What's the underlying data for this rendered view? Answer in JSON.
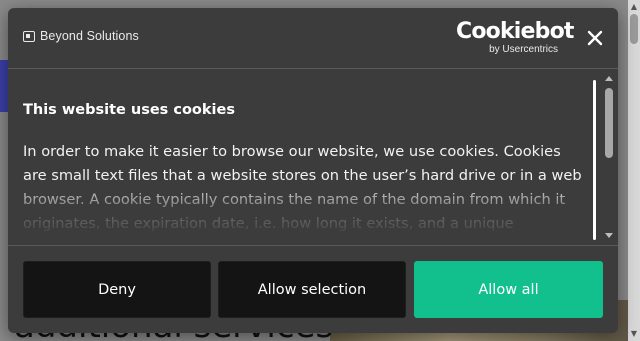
{
  "background_page": {
    "heading_fragment": "additional services"
  },
  "dialog": {
    "brand": {
      "name": "Beyond Solutions",
      "icon": "beyond-solutions-logo-icon"
    },
    "provider_logo": {
      "wordmark": "Cookiebot",
      "tagline": "by Usercentrics"
    },
    "close_icon": "close-icon",
    "title": "This website uses cookies",
    "body_text": "In order to make it easier to browse our website, we use cookies. Cookies are small text files that a website stores on the user’s hard drive or in a web browser. A cookie typically contains the name of the domain from which it originates, the expiration date, i.e. how long it exists, and a unique",
    "buttons": {
      "deny": "Deny",
      "allow_selection": "Allow selection",
      "allow_all": "Allow all"
    }
  },
  "colors": {
    "dialog_background": "#3c3c3c",
    "dark_button": "#141414",
    "accent_allow_all": "#12c08e",
    "text": "#ffffff"
  }
}
